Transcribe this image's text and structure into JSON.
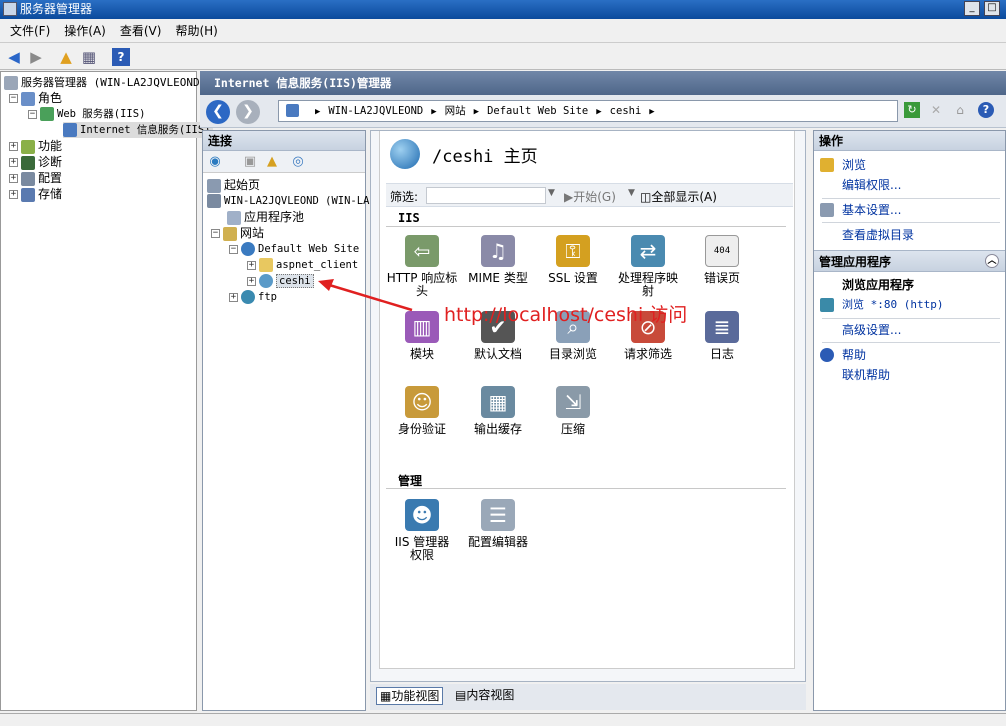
{
  "window": {
    "title": "服务器管理器",
    "min": "_",
    "max": "□"
  },
  "menu": [
    "文件(F)",
    "操作(A)",
    "查看(V)",
    "帮助(H)"
  ],
  "left_tree": {
    "root": "服务器管理器 (WIN-LA2JQVLEOND",
    "roles": "角色",
    "web_server": "Web 服务器(IIS)",
    "iis_mgr": "Internet 信息服务(IIS)",
    "features": "功能",
    "diagnostics": "诊断",
    "config": "配置",
    "storage": "存储"
  },
  "iis_header": "Internet 信息服务(IIS)管理器",
  "address": {
    "segments": [
      "WIN-LA2JQVLEOND",
      "网站",
      "Default Web Site",
      "ceshi"
    ]
  },
  "connections": {
    "title": "连接",
    "items": {
      "start": "起始页",
      "server": "WIN-LA2JQVLEOND (WIN-LA",
      "apppools": "应用程序池",
      "sites": "网站",
      "default_site": "Default Web Site",
      "aspnet": "aspnet_client",
      "ceshi": "ceshi",
      "ftp": "ftp"
    }
  },
  "main": {
    "title": "/ceshi 主页",
    "filter_label": "筛选:",
    "start_btn": "开始(G)",
    "show_all": "全部显示(A)",
    "group_iis": "IIS",
    "group_mgmt": "管理",
    "features_iis": [
      [
        "HTTP 响应标",
        "头"
      ],
      [
        "MIME 类型",
        ""
      ],
      [
        "SSL 设置",
        ""
      ],
      [
        "处理程序映",
        "射"
      ],
      [
        "错误页",
        ""
      ],
      [
        "模块",
        ""
      ],
      [
        "默认文档",
        ""
      ],
      [
        "目录浏览",
        ""
      ],
      [
        "请求筛选",
        ""
      ],
      [
        "日志",
        ""
      ],
      [
        "身份验证",
        ""
      ],
      [
        "输出缓存",
        ""
      ],
      [
        "压缩",
        ""
      ]
    ],
    "features_mgmt": [
      [
        "IIS 管理器",
        "权限"
      ],
      [
        "配置编辑器",
        ""
      ]
    ],
    "error_badge": "404"
  },
  "view_tabs": {
    "features": "功能视图",
    "content": "内容视图"
  },
  "actions": {
    "title": "操作",
    "browse": "浏览",
    "edit_perms": "编辑权限...",
    "basic_settings": "基本设置...",
    "view_vdirs": "查看虚拟目录",
    "manage_app": "管理应用程序",
    "browse_app": "浏览应用程序",
    "browse_port": "浏览 *:80 (http)",
    "advanced": "高级设置...",
    "help": "帮助",
    "online_help": "联机帮助"
  },
  "annotation": "http://localhost/ceshi 访问"
}
